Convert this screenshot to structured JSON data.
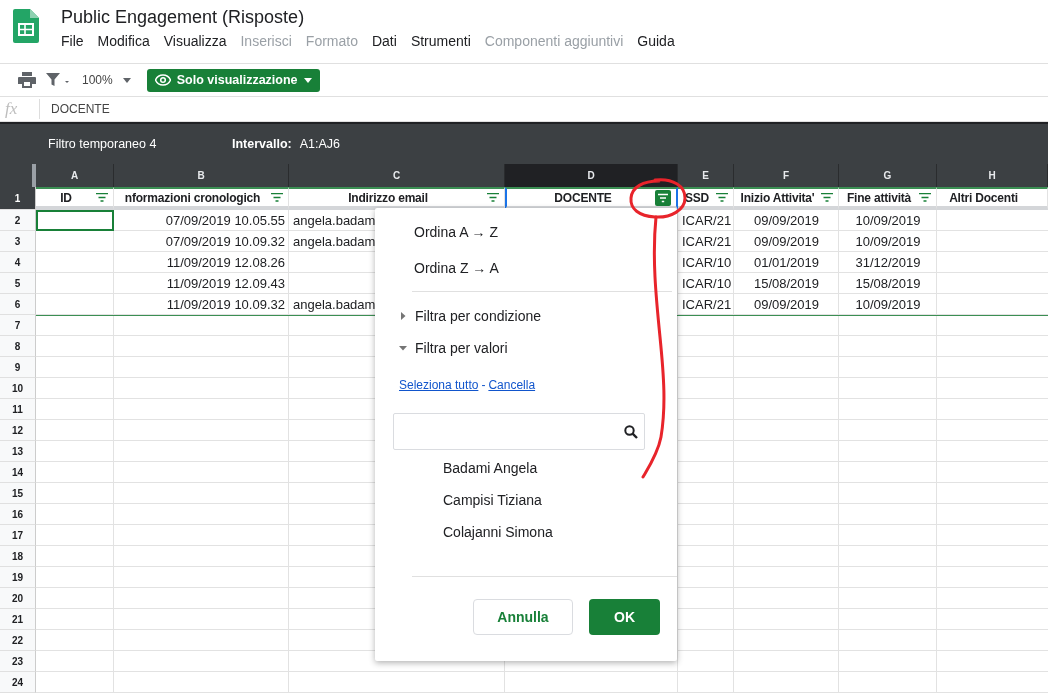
{
  "document": {
    "title": "Public Engagement (Risposte)"
  },
  "menu": [
    {
      "label": "File",
      "disabled": false
    },
    {
      "label": "Modifica",
      "disabled": false
    },
    {
      "label": "Visualizza",
      "disabled": false
    },
    {
      "label": "Inserisci",
      "disabled": true
    },
    {
      "label": "Formato",
      "disabled": true
    },
    {
      "label": "Dati",
      "disabled": false
    },
    {
      "label": "Strumenti",
      "disabled": false
    },
    {
      "label": "Componenti aggiuntivi",
      "disabled": true
    },
    {
      "label": "Guida",
      "disabled": false
    }
  ],
  "toolbar": {
    "zoom": "100%",
    "mode_button": "Solo visualizzazione"
  },
  "formula_bar": {
    "label": "fx",
    "value": "DOCENTE"
  },
  "filter_bar": {
    "name": "Filtro temporaneo 4",
    "range_label": "Intervallo:",
    "range": "A1:AJ6"
  },
  "columns": [
    {
      "letter": "A",
      "header": "ID",
      "filter_button": true,
      "selected": false
    },
    {
      "letter": "B",
      "header": "nformazioni cronologich",
      "filter_button": true,
      "selected": false
    },
    {
      "letter": "C",
      "header": "Indirizzo email",
      "filter_button": true,
      "selected": false
    },
    {
      "letter": "D",
      "header": "DOCENTE",
      "filter_button": true,
      "selected": true
    },
    {
      "letter": "E",
      "header": "SSD",
      "filter_button": true,
      "selected": false
    },
    {
      "letter": "F",
      "header": "Inizio Attivita'",
      "filter_button": true,
      "selected": false
    },
    {
      "letter": "G",
      "header": "Fine attività",
      "filter_button": true,
      "selected": false
    },
    {
      "letter": "H",
      "header": "Altri Docenti",
      "filter_button": false,
      "selected": false
    }
  ],
  "header_row": "1",
  "rows": [
    {
      "num": "2",
      "selected": true,
      "cells": [
        null,
        "07/09/2019 10.05.55",
        "angela.badam",
        null,
        "ICAR/21",
        "09/09/2019",
        "10/09/2019",
        null
      ]
    },
    {
      "num": "3",
      "selected": false,
      "cells": [
        null,
        "07/09/2019 10.09.32",
        "angela.badam",
        null,
        "ICAR/21",
        "09/09/2019",
        "10/09/2019",
        null
      ]
    },
    {
      "num": "4",
      "selected": false,
      "cells": [
        null,
        "11/09/2019 12.08.26",
        null,
        null,
        "ICAR/10",
        "01/01/2019",
        "31/12/2019",
        null
      ]
    },
    {
      "num": "5",
      "selected": false,
      "cells": [
        null,
        "11/09/2019 12.09.43",
        null,
        null,
        "ICAR/10",
        "15/08/2019",
        "15/08/2019",
        null
      ]
    },
    {
      "num": "6",
      "selected": false,
      "cells": [
        null,
        "11/09/2019 10.09.32",
        "angela.badam",
        null,
        "ICAR/21",
        "09/09/2019",
        "10/09/2019",
        null
      ]
    }
  ],
  "empty_rows": [
    "7",
    "8",
    "9",
    "10",
    "11",
    "12",
    "13",
    "14",
    "15",
    "16",
    "17",
    "18",
    "19",
    "20",
    "21",
    "22",
    "23",
    "24"
  ],
  "filter_menu": {
    "sort_options": [
      "Ordina A → Z",
      "Ordina Z → A"
    ],
    "sections": [
      {
        "label": "Filtra per condizione",
        "expanded": false
      },
      {
        "label": "Filtra per valori",
        "expanded": true
      }
    ],
    "links": [
      "Seleziona tutto",
      "Cancella"
    ],
    "link_separator": "-",
    "values": [
      "Badami Angela",
      "Campisi Tiziana",
      "Colajanni Simona"
    ],
    "buttons": [
      {
        "label": "Annulla",
        "kind": "secondary"
      },
      {
        "label": "OK",
        "kind": "primary"
      }
    ]
  }
}
